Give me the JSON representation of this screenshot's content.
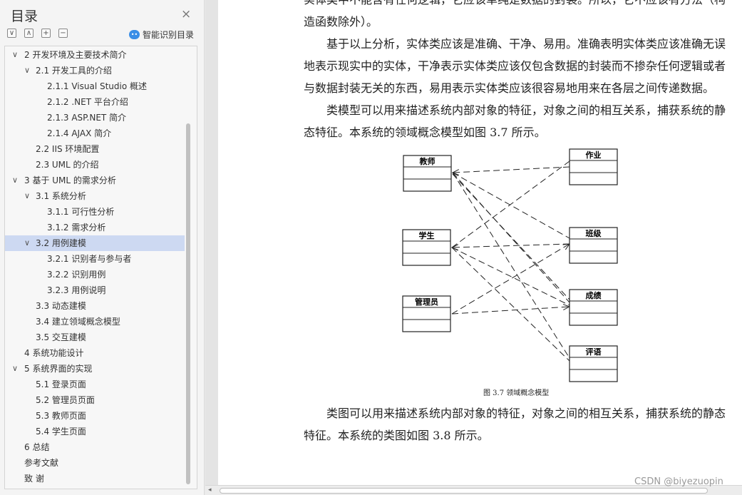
{
  "sidebar": {
    "title": "目录",
    "close_icon": "×",
    "tools": [
      "∨",
      "∧",
      "+",
      "−"
    ],
    "smart_label": "智能识别目录",
    "items": [
      {
        "label": "2  开发环境及主要技术简介",
        "level": 1,
        "chevron": "∨"
      },
      {
        "label": "2.1  开发工具的介绍",
        "level": 2,
        "chevron": "∨"
      },
      {
        "label": "2.1.1 Visual Studio 概述",
        "level": 3
      },
      {
        "label": "2.1.2 .NET 平台介绍",
        "level": 3
      },
      {
        "label": "2.1.3 ASP.NET 简介",
        "level": 3
      },
      {
        "label": "2.1.4 AJAX 简介",
        "level": 3
      },
      {
        "label": "2.2 IIS 环境配置",
        "level": 2
      },
      {
        "label": "2.3 UML 的介绍",
        "level": 2
      },
      {
        "label": "3  基于 UML 的需求分析",
        "level": 1,
        "chevron": "∨"
      },
      {
        "label": "3.1  系统分析",
        "level": 2,
        "chevron": "∨"
      },
      {
        "label": "3.1.1  可行性分析",
        "level": 3
      },
      {
        "label": "3.1.2  需求分析",
        "level": 3
      },
      {
        "label": "3.2  用例建模",
        "level": 2,
        "chevron": "∨",
        "selected": true
      },
      {
        "label": "3.2.1  识别者与参与者",
        "level": 3
      },
      {
        "label": "3.2.2  识别用例",
        "level": 3
      },
      {
        "label": "3.2.3  用例说明",
        "level": 3
      },
      {
        "label": "3.3  动态建模",
        "level": 2
      },
      {
        "label": "3.4  建立领域概念模型",
        "level": 2
      },
      {
        "label": "3.5  交互建模",
        "level": 2
      },
      {
        "label": "4  系统功能设计",
        "level": 1
      },
      {
        "label": "5  系统界面的实现",
        "level": 1,
        "chevron": "∨"
      },
      {
        "label": "5.1  登录页面",
        "level": 2
      },
      {
        "label": "5.2  管理员页面",
        "level": 2
      },
      {
        "label": "5.3  教师页面",
        "level": 2
      },
      {
        "label": "5.4  学生页面",
        "level": 2
      },
      {
        "label": "6  总结",
        "level": 1
      },
      {
        "label": "参考文献",
        "level": 1
      },
      {
        "label": "致    谢",
        "level": 1
      }
    ]
  },
  "document": {
    "para0": "实体类中不能含有任何逻辑，它应该单纯是数据的封装。所以，它不应该有方法（构造函数除外）。",
    "para1": "基于以上分析，实体类应该是准确、干净、易用。准确表明实体类应该准确无误地表示现实中的实体，干净表示实体类应该仅包含数据的封装而不掺杂任何逻辑或者与数据封装无关的东西，易用表示实体类应该很容易地用来在各层之间传递数据。",
    "para2": "类模型可以用来描述系统内部对象的特征，对象之间的相互关系，捕获系统的静态特征。本系统的领域概念模型如图 3.7 所示。",
    "para3": "类图可以用来描述系统内部对象的特征，对象之间的相互关系，捕获系统的静态特征。本系统的类图如图 3.8 所示。",
    "figure_caption": "图 3.7    领域概念模型",
    "diagram": {
      "left_classes": [
        "教师",
        "学生",
        "管理员"
      ],
      "right_classes": [
        "作业",
        "班级",
        "成绩",
        "评语"
      ]
    }
  },
  "watermark": "CSDN @biyezuopin",
  "h_scroll_left": "◂"
}
